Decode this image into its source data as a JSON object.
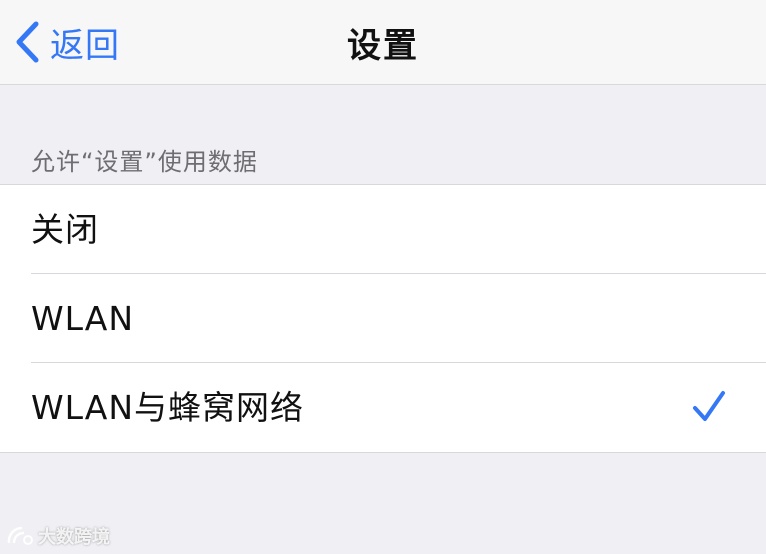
{
  "nav": {
    "back_label": "返回",
    "title": "设置"
  },
  "section": {
    "header": "允许“设置”使用数据"
  },
  "options": [
    {
      "label": "关闭",
      "selected": false
    },
    {
      "label": "WLAN",
      "selected": false
    },
    {
      "label": "WLAN与蜂窝网络",
      "selected": true
    }
  ],
  "watermark": {
    "text": "大数跨境"
  },
  "colors": {
    "accent": "#3478f6",
    "background": "#efeff4",
    "nav_background": "#f7f7f7",
    "separator": "#d8d8dc",
    "section_header": "#6d6d72"
  },
  "icons": {
    "back": "chevron-left-icon",
    "selected": "checkmark-icon"
  }
}
